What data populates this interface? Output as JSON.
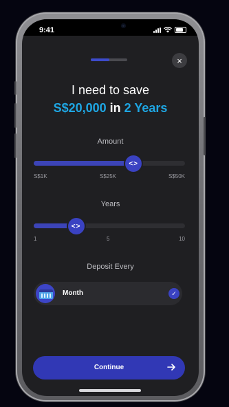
{
  "status_bar": {
    "time": "9:41"
  },
  "progress": {
    "fraction": 0.5
  },
  "close_icon": "×",
  "headline": {
    "line1": "I need to save",
    "amount": "S$20,000",
    "connector": " in ",
    "period": "2 Years"
  },
  "amount_slider": {
    "label": "Amount",
    "fraction": 0.66,
    "thumb_icon": "<>",
    "ticks": [
      "S$1K",
      "S$25K",
      "S$50K"
    ]
  },
  "years_slider": {
    "label": "Years",
    "fraction": 0.28,
    "thumb_icon": "<>",
    "ticks": [
      "1",
      "5",
      "10"
    ]
  },
  "deposit": {
    "label": "Deposit Every",
    "option": "Month",
    "check_icon": "✓"
  },
  "continue_button": {
    "label": "Continue"
  },
  "colors": {
    "accent": "#1ea6e3",
    "primary": "#3138b5",
    "background": "#1f1f22"
  }
}
